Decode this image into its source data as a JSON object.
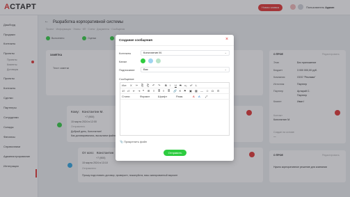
{
  "app": {
    "logo_accent": "А",
    "logo_rest": "СТАРТ",
    "top_button": "Новая заявка",
    "user_label": "Пользователь",
    "user_name": "Админ",
    "accent": "#e3312f",
    "green": "#2ecc40"
  },
  "sidebar": {
    "items": [
      "Дашборд",
      "Продажи",
      "Контакты",
      "Проекты",
      "Клиенты",
      "Проекты",
      "Контакты",
      "Сделки",
      "Партнеры",
      "Сотрудники",
      "Склады",
      "Финансы",
      "Справочники",
      "Администрирование",
      "Интеграции"
    ],
    "subitems": [
      "Проекты",
      "Клиенты",
      "Договоры"
    ]
  },
  "page": {
    "title": "Разработка корпоративной системы",
    "subtitle": "Проект · Информация · Этапы · КП · Счета · Документы · Сообщения",
    "steps": [
      "Выполнено",
      "Оценка",
      "В работе"
    ]
  },
  "left_card": {
    "title": "ЗАМЕТКА",
    "note": "Текст заметки"
  },
  "right_card": {
    "title": "О ПРОЕ",
    "edit": "Редактировать",
    "rows": [
      {
        "k": "Этап",
        "v": "Без приложение"
      },
      {
        "k": "Бюджет",
        "v": "3 000 000,00 руб."
      },
      {
        "k": "Компания",
        "v": "ООО \"Реклама\""
      },
      {
        "k": "Источник",
        "v": "Партнер"
      },
      {
        "k": "Партнер",
        "v": "Артарий С."
      },
      {
        "k": "",
        "v": "Партнер"
      },
      {
        "k": "Клиент",
        "v": "Иван !"
      }
    ],
    "contact_label": "Контакт",
    "contact": "Константин М.",
    "created_label": "Создан на основе",
    "created": "—"
  },
  "right_card2": {
    "title": "О ПРОЕ",
    "edit": "Редактировать",
    "text": "Нужно корпоративное решение для компании"
  },
  "messages": [
    {
      "label": "Кому:",
      "name": "Константин М.",
      "phone": "+7 (900)",
      "date": "15 марта 2024 в 12:00",
      "status": "Отправлено",
      "greet": "Добрый день, Константин!",
      "body": "Как договаривались, высылаем файлы по проекту"
    },
    {
      "label": "От кого:",
      "name": "Константин",
      "phone": "+7 (900)",
      "date": "15 марта 2024 в 13:10",
      "status": "Отправлено",
      "greet": "",
      "body": "Прошу подготовить договор, проверьте, пожалуйста, ваш сканированный вариант"
    }
  ],
  "modal": {
    "title": "Создание сообщения",
    "contacts_label": "Контакты",
    "contacts_value": "Константин М.",
    "channel_label": "Канал",
    "sign_label": "Подписание",
    "sign_value": "Вас",
    "message_label": "Сообщение",
    "toolbar_row1": [
      "Ист.",
      "Х",
      "✂",
      "⎘",
      "⎗",
      "↶",
      "↷",
      "B",
      "I",
      "U",
      "S",
      "x₂",
      "x²",
      "I̶"
    ],
    "toolbar_row2": [
      "1≡",
      "•≡",
      "⇤",
      "⇥",
      "❝",
      "⊞",
      "≡",
      "≣",
      "≡",
      "≣",
      "🔗",
      "✕",
      "⚑",
      "▣",
      "▦",
      "―",
      "☺",
      "Ω",
      "⊡"
    ],
    "toolbar_row3": [
      "Стили",
      "Формат",
      "Шрифт",
      "Разм.",
      "A",
      "A",
      "⤢"
    ],
    "attach": "Прикрепить файл",
    "send": "Отправить",
    "channel_icons": [
      "whatsapp-icon",
      "telegram-icon",
      "viber-icon"
    ]
  }
}
